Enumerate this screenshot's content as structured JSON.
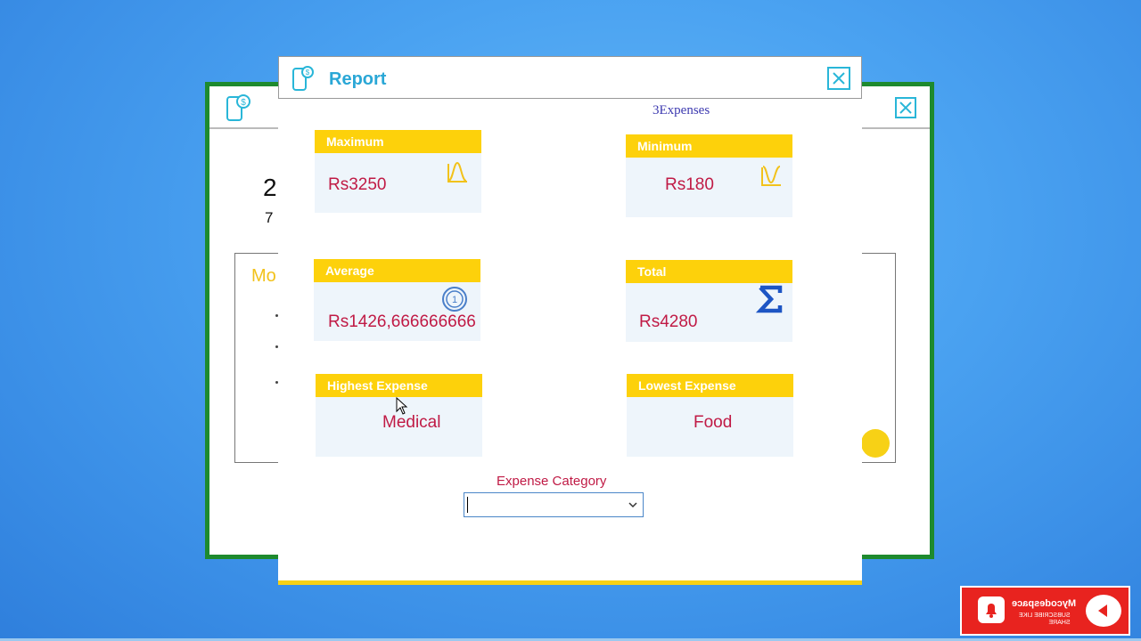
{
  "back_window": {
    "big_number": "2",
    "small_number": "7",
    "panel_label": "Mo"
  },
  "report": {
    "title": "Report",
    "expense_count": "3Expenses",
    "cards": {
      "maximum": {
        "label": "Maximum",
        "value": "Rs3250",
        "icon": "bell-curve-peak-icon"
      },
      "minimum": {
        "label": "Minimum",
        "value": "Rs180",
        "icon": "valley-curve-icon"
      },
      "average": {
        "label": "Average",
        "value": "Rs1426,666666666",
        "icon": "coin-icon"
      },
      "total": {
        "label": "Total",
        "value": "Rs4280",
        "icon": "sigma-icon"
      },
      "highest": {
        "label": "Highest Expense",
        "value": "Medical"
      },
      "lowest": {
        "label": "Lowest Expense",
        "value": "Food"
      }
    },
    "category": {
      "label": "Expense Category",
      "selected": ""
    }
  },
  "watermark": {
    "channel": "Mycodespace",
    "sub1": "SUBSCRIBE LIKE",
    "sub2": "SHARE"
  },
  "colors": {
    "accent_yellow": "#fdd10b",
    "value_red": "#c01a45",
    "title_blue": "#2aa7d6",
    "frame_green": "#1e8a2e"
  }
}
